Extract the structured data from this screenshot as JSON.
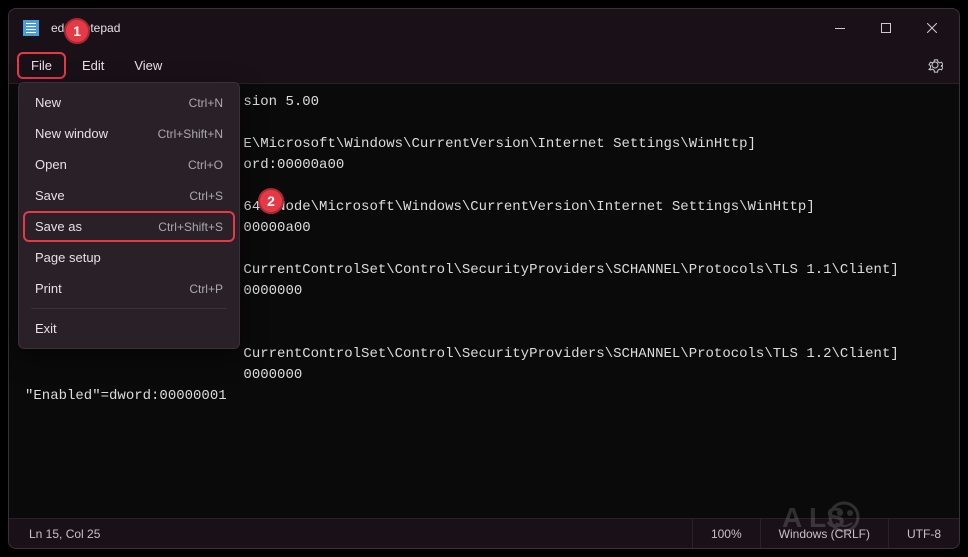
{
  "window": {
    "title": "ed - Notepad"
  },
  "menubar": {
    "file": "File",
    "edit": "Edit",
    "view": "View"
  },
  "dropdown": {
    "items": [
      {
        "label": "New",
        "shortcut": "Ctrl+N"
      },
      {
        "label": "New window",
        "shortcut": "Ctrl+Shift+N"
      },
      {
        "label": "Open",
        "shortcut": "Ctrl+O"
      },
      {
        "label": "Save",
        "shortcut": "Ctrl+S"
      },
      {
        "label": "Save as",
        "shortcut": "Ctrl+Shift+S"
      },
      {
        "label": "Page setup",
        "shortcut": ""
      },
      {
        "label": "Print",
        "shortcut": "Ctrl+P"
      },
      {
        "label": "Exit",
        "shortcut": ""
      }
    ]
  },
  "editor": {
    "content": "                          sion 5.00\n\n                          E\\Microsoft\\Windows\\CurrentVersion\\Internet Settings\\WinHttp]\n                          ord:00000a00\n\n                          6432Node\\Microsoft\\Windows\\CurrentVersion\\Internet Settings\\WinHttp]\n                          00000a00\n\n                          CurrentControlSet\\Control\\SecurityProviders\\SCHANNEL\\Protocols\\TLS 1.1\\Client]\n                          0000000\n\n\n                          CurrentControlSet\\Control\\SecurityProviders\\SCHANNEL\\Protocols\\TLS 1.2\\Client]\n                          0000000\n\"Enabled\"=dword:00000001"
  },
  "statusbar": {
    "position": "Ln 15, Col 25",
    "zoom": "100%",
    "lineending": "Windows (CRLF)",
    "encoding": "UTF-8"
  },
  "callouts": {
    "one": "1",
    "two": "2"
  }
}
